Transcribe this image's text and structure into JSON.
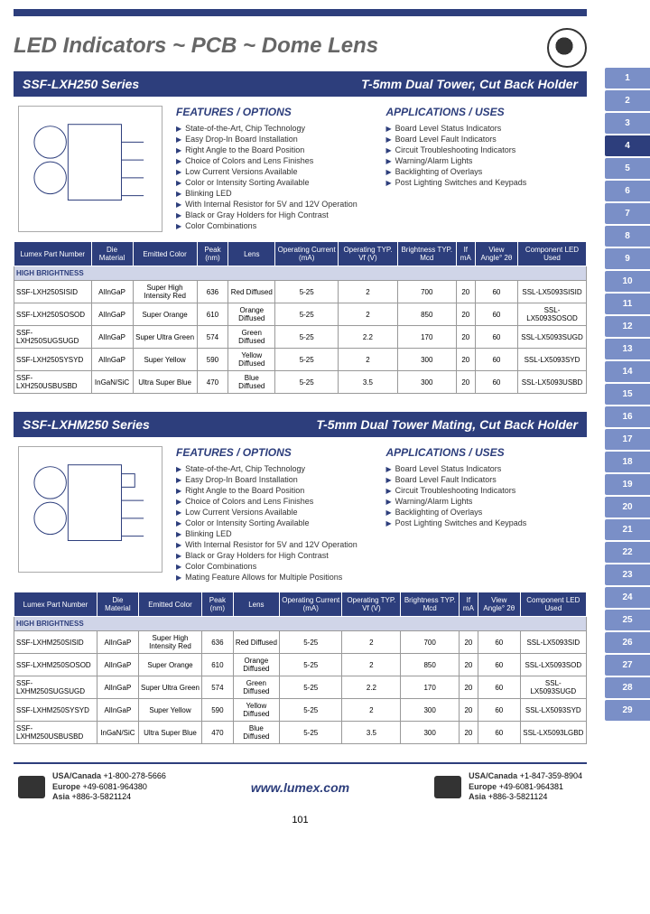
{
  "header": {
    "title": "LED Indicators ~ PCB ~ Dome Lens"
  },
  "series1": {
    "name": "SSF-LXH250 Series",
    "subtitle": "T-5mm Dual Tower, Cut Back Holder",
    "features_title": "FEATURES / OPTIONS",
    "features": [
      "State-of-the-Art, Chip Technology",
      "Easy Drop-In Board Installation",
      "Right Angle to the Board Position",
      "Choice of Colors and Lens Finishes",
      "Low Current Versions Available",
      "Color or Intensity Sorting Available",
      "Blinking LED",
      "With Internal Resistor for 5V and 12V Operation",
      "Black or Gray Holders for High Contrast",
      "Color Combinations"
    ],
    "apps_title": "APPLICATIONS / USES",
    "apps": [
      "Board Level Status Indicators",
      "Board Level Fault Indicators",
      "Circuit Troubleshooting Indicators",
      "Warning/Alarm Lights",
      "Backlighting of Overlays",
      "Post Lighting Switches and Keypads"
    ],
    "table": {
      "headers": [
        "Lumex Part Number",
        "Die Material",
        "Emitted Color",
        "Peak (nm)",
        "Lens",
        "Operating Current (mA)",
        "Operating TYP. Vf (V)",
        "Brightness TYP. Mcd",
        "If mA",
        "View Angle° 2θ",
        "Component LED Used"
      ],
      "section_label": "HIGH BRIGHTNESS",
      "rows": [
        [
          "SSF-LXH250SISID",
          "AlInGaP",
          "Super High Intensity Red",
          "636",
          "Red Diffused",
          "5-25",
          "2",
          "700",
          "20",
          "60",
          "SSL-LX5093SISID"
        ],
        [
          "SSF-LXH250SOSOD",
          "AlInGaP",
          "Super Orange",
          "610",
          "Orange Diffused",
          "5-25",
          "2",
          "850",
          "20",
          "60",
          "SSL-LX5093SOSOD"
        ],
        [
          "SSF-LXH250SUGSUGD",
          "AlInGaP",
          "Super Ultra Green",
          "574",
          "Green Diffused",
          "5-25",
          "2.2",
          "170",
          "20",
          "60",
          "SSL-LX5093SUGD"
        ],
        [
          "SSF-LXH250SYSYD",
          "AlInGaP",
          "Super Yellow",
          "590",
          "Yellow Diffused",
          "5-25",
          "2",
          "300",
          "20",
          "60",
          "SSL-LX5093SYD"
        ],
        [
          "SSF-LXH250USBUSBD",
          "InGaN/SiC",
          "Ultra Super Blue",
          "470",
          "Blue Diffused",
          "5-25",
          "3.5",
          "300",
          "20",
          "60",
          "SSL-LX5093USBD"
        ]
      ]
    }
  },
  "series2": {
    "name": "SSF-LXHM250 Series",
    "subtitle": "T-5mm Dual Tower Mating, Cut Back Holder",
    "features_title": "FEATURES / OPTIONS",
    "features": [
      "State-of-the-Art, Chip Technology",
      "Easy Drop-In Board Installation",
      "Right Angle to the Board Position",
      "Choice of Colors and Lens Finishes",
      "Low Current Versions Available",
      "Color or Intensity Sorting Available",
      "Blinking LED",
      "With Internal Resistor for 5V and 12V Operation",
      "Black or Gray Holders for High Contrast",
      "Color Combinations",
      "Mating Feature Allows for Multiple Positions"
    ],
    "apps_title": "APPLICATIONS / USES",
    "apps": [
      "Board Level Status Indicators",
      "Board Level Fault Indicators",
      "Circuit Troubleshooting Indicators",
      "Warning/Alarm Lights",
      "Backlighting of Overlays",
      "Post Lighting Switches and Keypads"
    ],
    "table": {
      "headers": [
        "Lumex Part Number",
        "Die Material",
        "Emitted Color",
        "Peak (nm)",
        "Lens",
        "Operating Current (mA)",
        "Operating TYP. Vf (V)",
        "Brightness TYP. Mcd",
        "If mA",
        "View Angle° 2θ",
        "Component LED Used"
      ],
      "section_label": "HIGH BRIGHTNESS",
      "rows": [
        [
          "SSF-LXHM250SISID",
          "AlInGaP",
          "Super High Intensity Red",
          "636",
          "Red Diffused",
          "5-25",
          "2",
          "700",
          "20",
          "60",
          "SSL-LX5093SID"
        ],
        [
          "SSF-LXHM250SOSOD",
          "AlInGaP",
          "Super Orange",
          "610",
          "Orange Diffused",
          "5-25",
          "2",
          "850",
          "20",
          "60",
          "SSL-LX5093SOD"
        ],
        [
          "SSF-LXHM250SUGSUGD",
          "AlInGaP",
          "Super Ultra Green",
          "574",
          "Green Diffused",
          "5-25",
          "2.2",
          "170",
          "20",
          "60",
          "SSL-LX5093SUGD"
        ],
        [
          "SSF-LXHM250SYSYD",
          "AlInGaP",
          "Super Yellow",
          "590",
          "Yellow Diffused",
          "5-25",
          "2",
          "300",
          "20",
          "60",
          "SSL-LX5093SYD"
        ],
        [
          "SSF-LXHM250USBUSBD",
          "InGaN/SiC",
          "Ultra Super Blue",
          "470",
          "Blue Diffused",
          "5-25",
          "3.5",
          "300",
          "20",
          "60",
          "SSL-LX5093LGBD"
        ]
      ]
    }
  },
  "footer": {
    "left": {
      "usa_label": "USA/Canada",
      "usa_phone": "+1-800-278-5666",
      "eu_label": "Europe",
      "eu_phone": "+49-6081-964380",
      "asia_label": "Asia",
      "asia_phone": "+886-3-5821124"
    },
    "website": "www.lumex.com",
    "right": {
      "usa_label": "USA/Canada",
      "usa_phone": "+1-847-359-8904",
      "eu_label": "Europe",
      "eu_phone": "+49-6081-964381",
      "asia_label": "Asia",
      "asia_phone": "+886-3-5821124"
    },
    "page_number": "101"
  },
  "tabs": [
    "1",
    "2",
    "3",
    "4",
    "5",
    "6",
    "7",
    "8",
    "9",
    "10",
    "11",
    "12",
    "13",
    "14",
    "15",
    "16",
    "17",
    "18",
    "19",
    "20",
    "21",
    "22",
    "23",
    "24",
    "25",
    "26",
    "27",
    "28",
    "29"
  ],
  "active_tab": 3
}
